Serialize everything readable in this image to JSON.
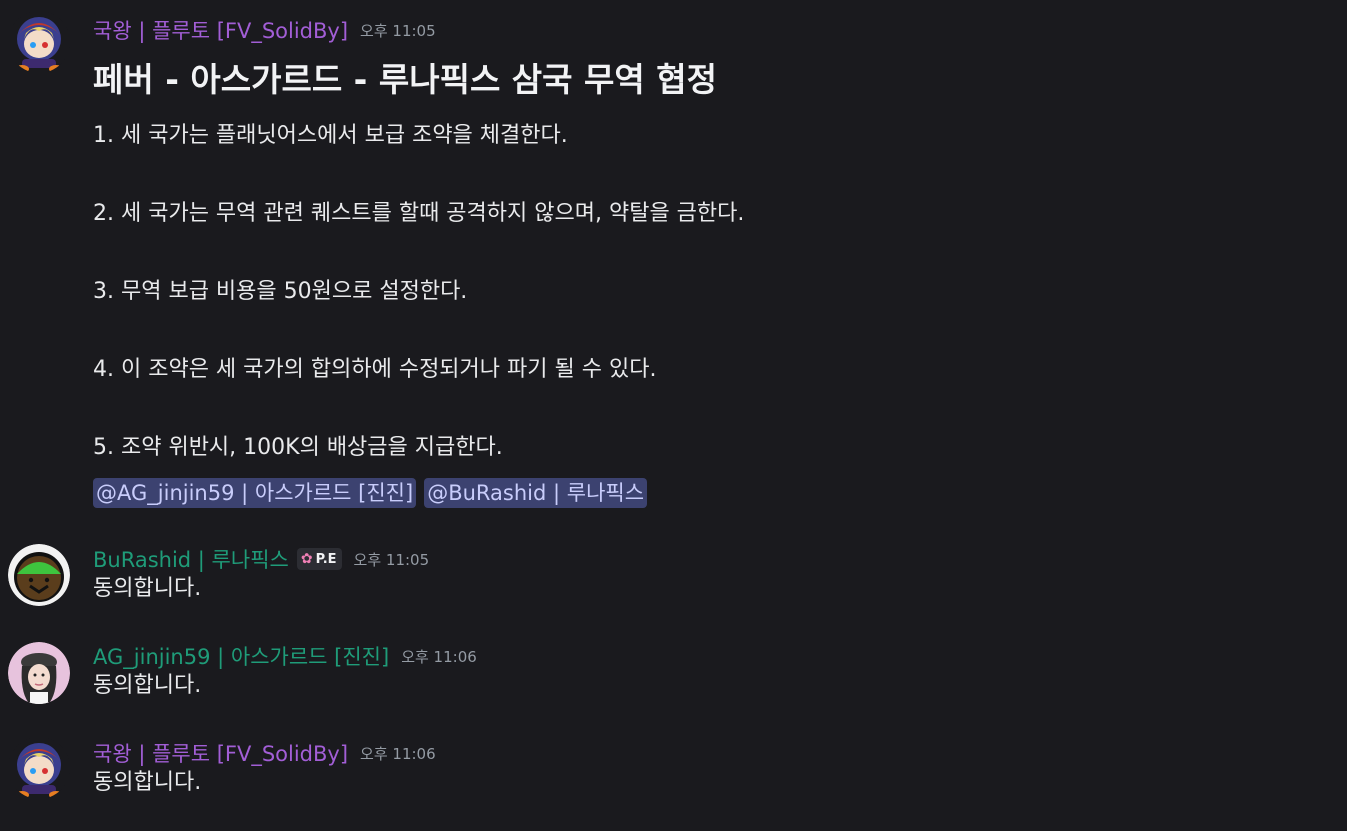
{
  "messages": [
    {
      "author": "국왕 | 플루토  [FV_SolidBy]",
      "timestamp": "오후 11:05",
      "title": "페버 - 아스가르드 - 루나픽스 삼국 무역 협정",
      "lines": [
        "1. 세 국가는 플래닛어스에서 보급 조약을 체결한다.",
        "2. 세 국가는 무역 관련 퀘스트를 할때 공격하지 않으며, 약탈을 금한다.",
        "3. 무역 보급 비용을 50원으로 설정한다.",
        "4. 이 조약은 세 국가의 합의하에 수정되거나 파기 될 수 있다.",
        "5. 조약 위반시, 100K의 배상금을 지급한다."
      ],
      "mentions": [
        "@AG_jinjin59 | 아스가르드 [진진]",
        "@BuRashid | 루나픽스"
      ]
    },
    {
      "author": "BuRashid | 루나픽스",
      "badge": "P.E",
      "badge_icon": "cherry-blossom-icon",
      "timestamp": "오후 11:05",
      "text": "동의합니다."
    },
    {
      "author": "AG_jinjin59 | 아스가르드 [진진]",
      "timestamp": "오후 11:06",
      "text": "동의합니다."
    },
    {
      "author": "국왕 | 플루토  [FV_SolidBy]",
      "timestamp": "오후 11:06",
      "text": "동의합니다."
    }
  ],
  "colors": {
    "background": "#1a1a1e",
    "author_purple": "#a25ed6",
    "author_green": "#1f9c79",
    "mention_bg": "#3c4270",
    "mention_text": "#c9cdfb"
  }
}
